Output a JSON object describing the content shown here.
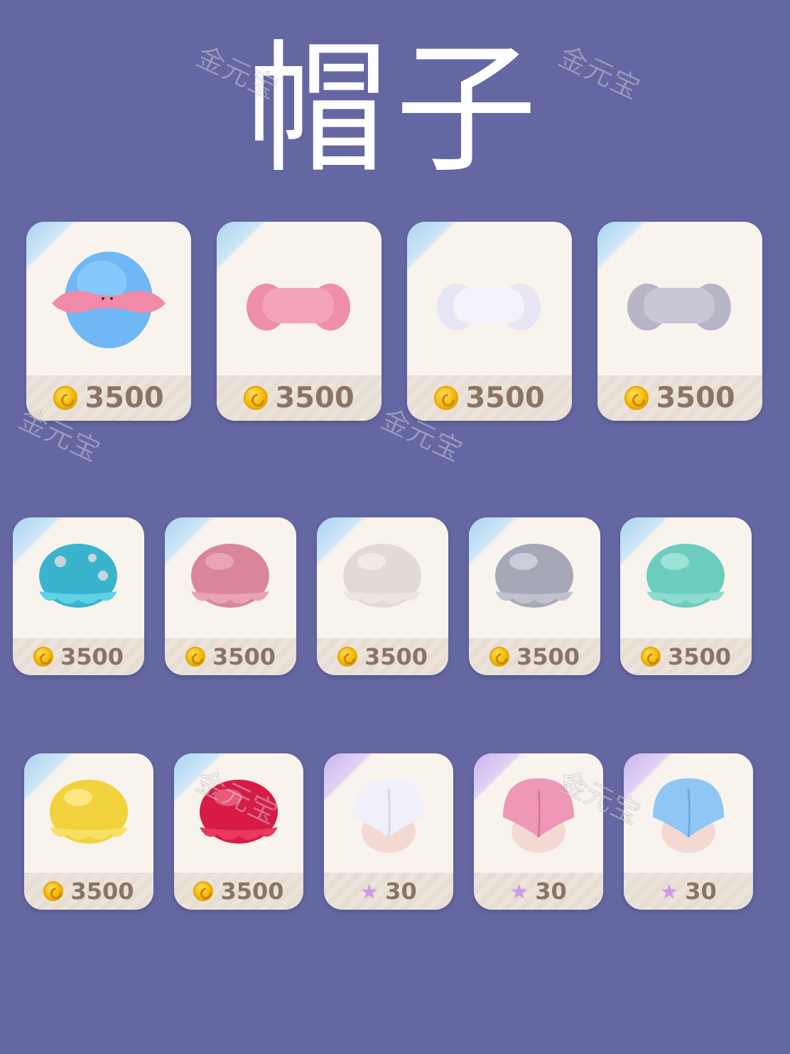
{
  "title": "帽子",
  "watermark": "金元宝",
  "rows": [
    {
      "items": [
        {
          "name": "blue-hair-pink-headband",
          "currency": "coin",
          "price": "3500"
        },
        {
          "name": "pink-towel-headband",
          "currency": "coin",
          "price": "3500"
        },
        {
          "name": "white-towel-headband",
          "currency": "coin",
          "price": "3500"
        },
        {
          "name": "grey-towel-headband",
          "currency": "coin",
          "price": "3500"
        }
      ]
    },
    {
      "items": [
        {
          "name": "cyan-star-shower-cap",
          "currency": "coin",
          "price": "3500"
        },
        {
          "name": "pink-shower-cap",
          "currency": "coin",
          "price": "3500"
        },
        {
          "name": "cream-shower-cap",
          "currency": "coin",
          "price": "3500"
        },
        {
          "name": "silver-shower-cap",
          "currency": "coin",
          "price": "3500"
        },
        {
          "name": "mint-shower-cap",
          "currency": "coin",
          "price": "3500"
        }
      ]
    },
    {
      "items": [
        {
          "name": "yellow-shower-cap",
          "currency": "coin",
          "price": "3500"
        },
        {
          "name": "red-shower-cap",
          "currency": "coin",
          "price": "3500"
        },
        {
          "name": "white-hair-towel",
          "currency": "star",
          "price": "30"
        },
        {
          "name": "pink-hair-towel",
          "currency": "star",
          "price": "30"
        },
        {
          "name": "blue-hair-towel",
          "currency": "star",
          "price": "30"
        }
      ]
    }
  ],
  "colors": {
    "background": "#6467a2",
    "card": "#f8f3ed",
    "price_text": "#8a7466",
    "coin": "#f5b800",
    "star": "#c99be8"
  }
}
